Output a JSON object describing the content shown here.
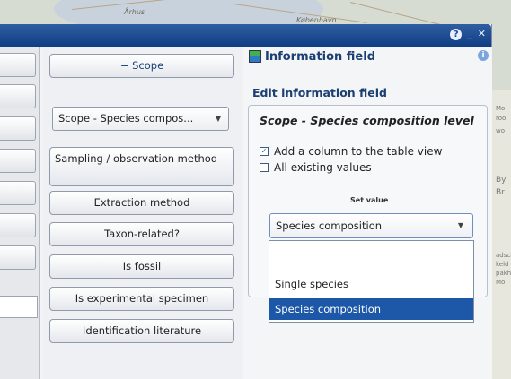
{
  "map": {
    "labels": [
      "Århus",
      "København"
    ],
    "right_labels": [
      "Mo",
      "roo",
      "wo",
      "By",
      "Br",
      "adsch",
      "keld",
      "pakh",
      "Mo"
    ]
  },
  "window": {
    "title_controls": {
      "help": "?",
      "minimize": "_",
      "close": "✕"
    }
  },
  "left_stubs": {
    "count": 7
  },
  "middle": {
    "scope_button": "− Scope",
    "scope_combo": "Scope - Species compos...",
    "buttons": [
      "Sampling / observation method",
      "Extraction method",
      "Taxon-related?",
      "Is fossil",
      "Is experimental specimen",
      "Identification literature"
    ]
  },
  "panel": {
    "title": "Information field",
    "info_icon": "i",
    "subtitle": "Edit information field",
    "field_title": "Scope - Species composition level",
    "checkbox_add_column": {
      "label": "Add a column to the table view",
      "checked": true
    },
    "checkbox_all_values": {
      "label": "All existing values",
      "checked": false
    },
    "set_value_label": "Set value",
    "dropdown_value": "Species composition",
    "dropdown_options": [
      "",
      "Single species",
      "Species composition"
    ],
    "dropdown_selected_index": 2
  },
  "colors": {
    "titlebar": "#1a4c92",
    "selection": "#1d58a8",
    "heading": "#1c3f74"
  }
}
